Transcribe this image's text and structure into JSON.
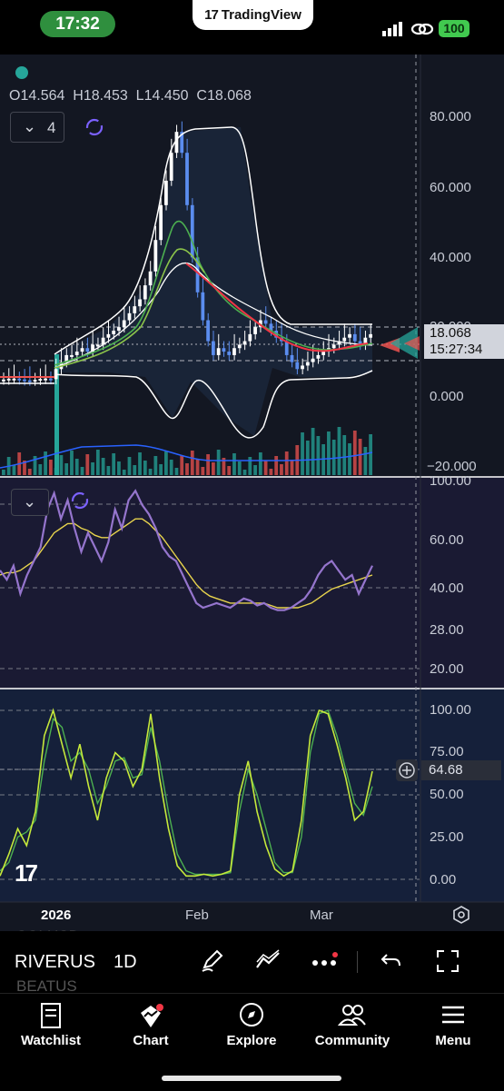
{
  "status": {
    "time": "17:32",
    "app_pill": "TradingView",
    "battery": "100"
  },
  "header": {
    "ohlc_open": "O14.564",
    "ohlc_high": "H18.453",
    "ohlc_low": "L14.450",
    "ohlc_close": "C18.068",
    "indicator_count": "4"
  },
  "price_axis": {
    "labels": [
      "80.000",
      "60.000",
      "40.000",
      "20.000",
      "0.000",
      "−20.000"
    ],
    "last_price": "18.068",
    "countdown": "15:27:34"
  },
  "rsi_axis": {
    "labels": [
      "100.00",
      "60.00",
      "40.00",
      "28.00",
      "20.00"
    ]
  },
  "stoch_axis": {
    "labels": [
      "100.00",
      "75.00",
      "50.00",
      "25.00",
      "0.00"
    ],
    "crosshair_value": "64.68"
  },
  "time_axis": {
    "labels": [
      "2026",
      "Feb",
      "Mar"
    ]
  },
  "toolbar": {
    "symbol": "RIVERUS",
    "interval": "1D",
    "ghost_prev": "SOLUSD",
    "ghost_next": "BEATUS"
  },
  "tabs": [
    {
      "label": "Watchlist",
      "icon": "book-icon"
    },
    {
      "label": "Chart",
      "icon": "chart-icon"
    },
    {
      "label": "Explore",
      "icon": "compass-icon"
    },
    {
      "label": "Community",
      "icon": "people-icon"
    },
    {
      "label": "Menu",
      "icon": "hamburger-icon"
    }
  ],
  "colors": {
    "background": "#131722",
    "up": "#26a69a",
    "down": "#ef5350",
    "candle_up": "#5b8def",
    "rsi": "#9575cd",
    "rsi_ma": "#e8d44d",
    "stoch_k": "#c6e93a",
    "stoch_d": "#4caf50",
    "ema_fast": "#4caf50",
    "ema_slow": "#f23645",
    "bands": "#ffffff"
  }
}
